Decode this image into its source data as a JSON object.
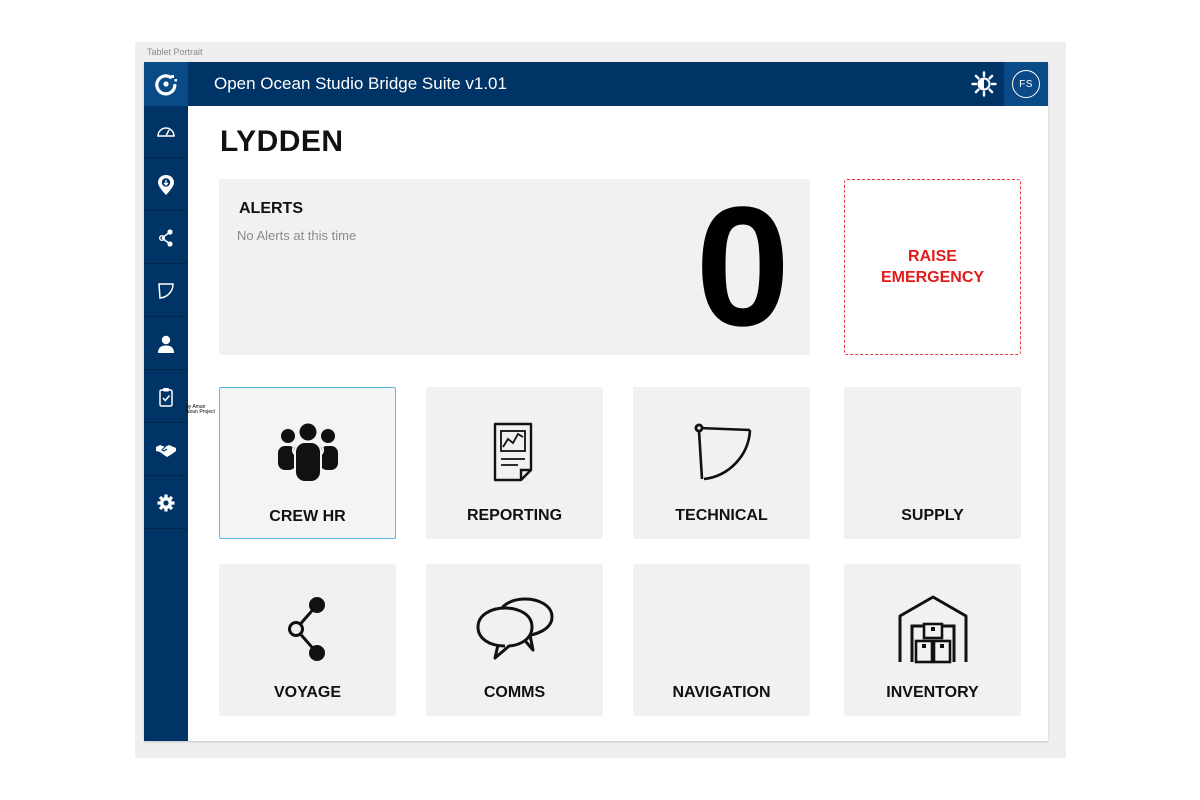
{
  "artboard": {
    "label": "Tablet Portrait"
  },
  "header": {
    "title": "Open Ocean Studio Bridge Suite v1.01",
    "avatar_initials": "FS",
    "icons": [
      "brightness-icon",
      "help-icon"
    ]
  },
  "sidebar": {
    "items": [
      {
        "name": "dashboard-icon"
      },
      {
        "name": "location-pin-icon"
      },
      {
        "name": "share-icon"
      },
      {
        "name": "technical-icon"
      },
      {
        "name": "user-icon"
      },
      {
        "name": "clipboard-icon"
      },
      {
        "name": "handshake-icon"
      },
      {
        "name": "settings-icon"
      }
    ]
  },
  "vessel": {
    "name": "LYDDEN"
  },
  "alerts": {
    "title": "ALERTS",
    "message": "No Alerts at this time",
    "count": "0"
  },
  "emergency": {
    "label": "RAISE EMERGENCY"
  },
  "modules": [
    {
      "label": "CREW HR",
      "icon": "crew-icon",
      "active": true
    },
    {
      "label": "REPORTING",
      "icon": "report-icon"
    },
    {
      "label": "TECHNICAL",
      "icon": "technical-icon"
    },
    {
      "label": "SUPPLY",
      "icon": ""
    },
    {
      "label": "VOYAGE",
      "icon": "share-icon"
    },
    {
      "label": "COMMS",
      "icon": "chat-icon"
    },
    {
      "label": "NAVIGATION",
      "icon": ""
    },
    {
      "label": "INVENTORY",
      "icon": "warehouse-icon"
    }
  ],
  "stray_text": [
    "by Aman",
    "Noun Project"
  ],
  "colors": {
    "navy": "#003366",
    "accent": "#5db7e8",
    "emergency": "#e21b1b"
  }
}
